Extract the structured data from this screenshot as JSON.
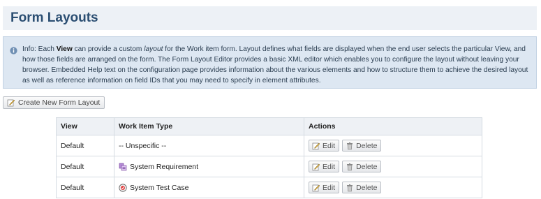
{
  "header": {
    "title": "Form Layouts"
  },
  "info": {
    "prefix": "Info: Each ",
    "bold_word": "View",
    "mid1": " can provide a custom ",
    "italic_word": "layout",
    "rest": " for the Work item form. Layout defines what fields are displayed when the end user selects the particular View, and how those fields are arranged on the form. The Form Layout Editor provides a basic XML editor which enables you to configure the layout without leaving your browser. Embedded Help text on the configuration page provides information about the various elements and how to structure them to achieve the desired layout as well as reference information on field IDs that you may need to specify in element attributes."
  },
  "toolbar": {
    "create_label": "Create New Form Layout"
  },
  "table": {
    "headers": {
      "view": "View",
      "type": "Work Item Type",
      "actions": "Actions"
    },
    "rows": [
      {
        "view": "Default",
        "type": "-- Unspecific --",
        "icon": "none",
        "edit": "Edit",
        "delete": "Delete"
      },
      {
        "view": "Default",
        "type": "System Requirement",
        "icon": "requirement-icon",
        "edit": "Edit",
        "delete": "Delete"
      },
      {
        "view": "Default",
        "type": "System Test Case",
        "icon": "testcase-icon",
        "edit": "Edit",
        "delete": "Delete"
      }
    ]
  },
  "colors": {
    "title": "#2b4e72",
    "info_bg": "#dde7f2",
    "header_bg": "#edf1f6"
  }
}
